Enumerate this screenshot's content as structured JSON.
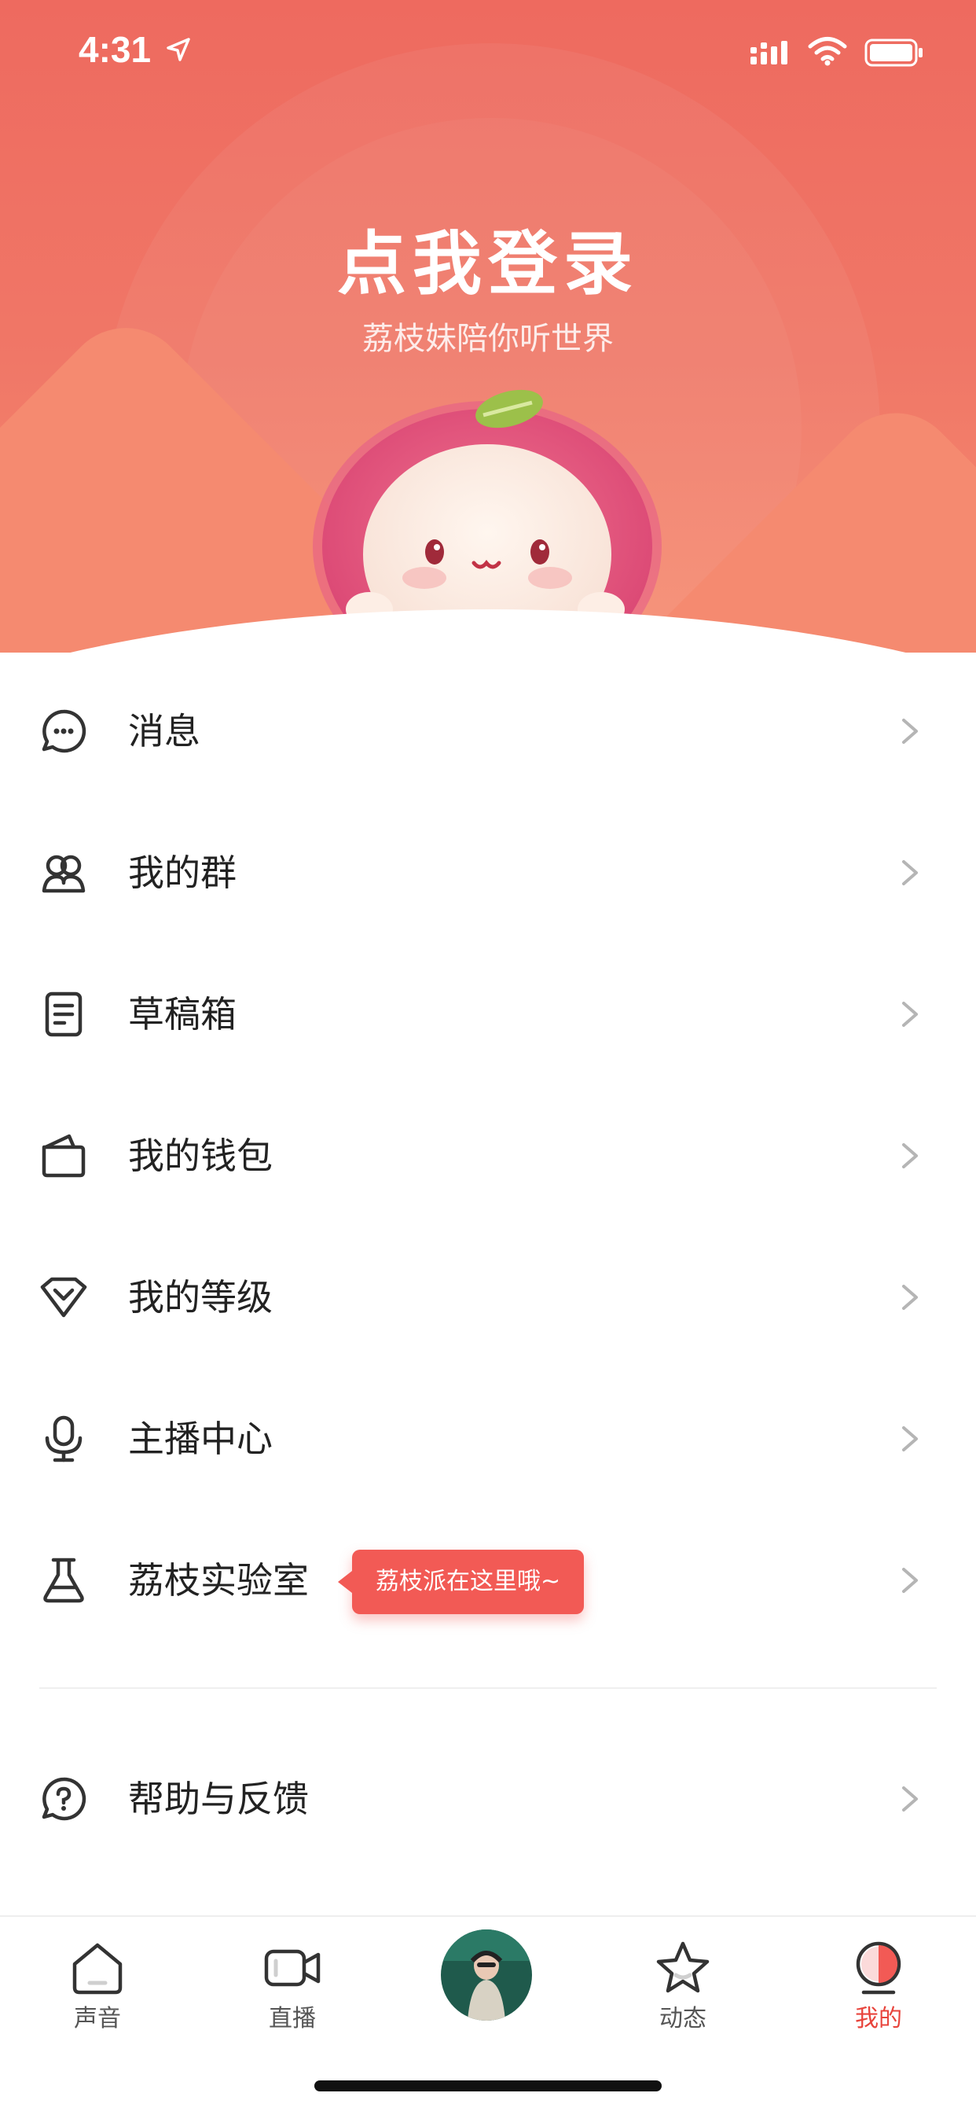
{
  "status_bar": {
    "time": "4:31"
  },
  "hero": {
    "title": "点我登录",
    "subtitle": "荔枝妹陪你听世界"
  },
  "menu": {
    "items": [
      {
        "label": "消息",
        "icon": "message-icon"
      },
      {
        "label": "我的群",
        "icon": "group-icon"
      },
      {
        "label": "草稿箱",
        "icon": "draft-icon"
      },
      {
        "label": "我的钱包",
        "icon": "wallet-icon"
      },
      {
        "label": "我的等级",
        "icon": "level-icon"
      },
      {
        "label": "主播中心",
        "icon": "microphone-icon"
      },
      {
        "label": "荔枝实验室",
        "icon": "lab-flask-icon",
        "tooltip": "荔枝派在这里哦~"
      },
      {
        "label": "帮助与反馈",
        "icon": "help-icon"
      }
    ]
  },
  "tabbar": {
    "tabs": [
      {
        "label": "声音",
        "icon": "home-icon"
      },
      {
        "label": "直播",
        "icon": "video-camera-icon"
      },
      {
        "label": "",
        "icon": "center-avatar"
      },
      {
        "label": "动态",
        "icon": "star-icon"
      },
      {
        "label": "我的",
        "icon": "profile-icon",
        "active": true
      }
    ]
  },
  "colors": {
    "accent": "#e8443c",
    "hero_top": "#ee6a5f",
    "hero_bottom": "#f68b6f",
    "tooltip": "#f25a55"
  }
}
